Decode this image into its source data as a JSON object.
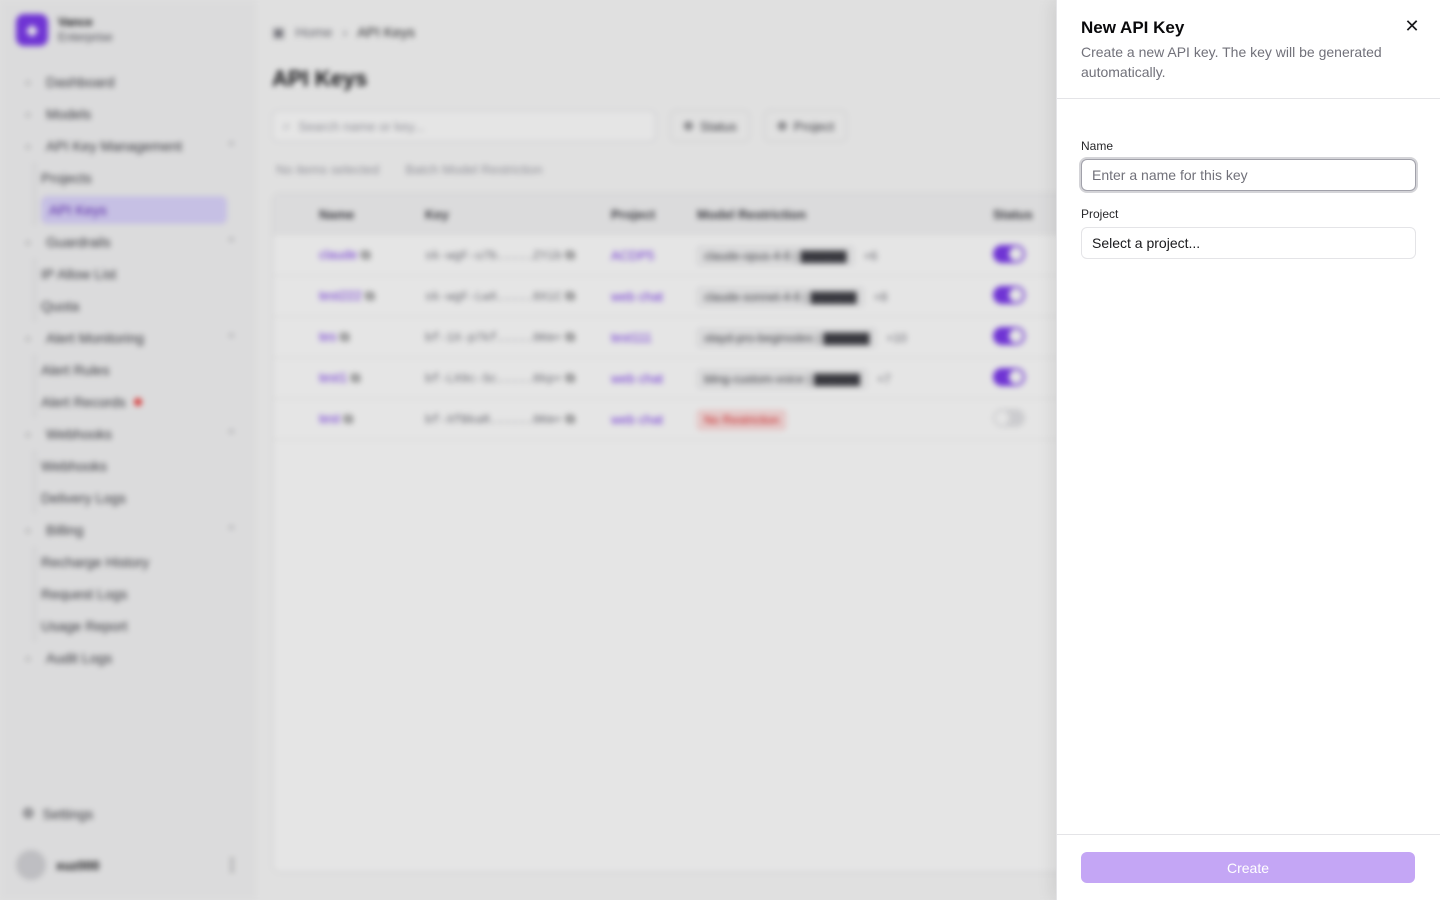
{
  "sidebar": {
    "brand_name": "Vance",
    "brand_sub": "Enterprise",
    "items": [
      {
        "label": "Dashboard",
        "type": "item",
        "icon": "dashboard-icon"
      },
      {
        "label": "Models",
        "type": "item",
        "icon": "models-icon"
      },
      {
        "label": "API Key Management",
        "type": "group",
        "icon": "key-icon"
      },
      {
        "label": "Projects",
        "type": "sub"
      },
      {
        "label": "API Keys",
        "type": "sub",
        "active": true
      },
      {
        "label": "Guardrails",
        "type": "group",
        "icon": "shield-icon"
      },
      {
        "label": "IP Allow List",
        "type": "sub"
      },
      {
        "label": "Quota",
        "type": "sub"
      },
      {
        "label": "Alert Monitoring",
        "type": "group",
        "icon": "alert-icon"
      },
      {
        "label": "Alert Rules",
        "type": "sub"
      },
      {
        "label": "Alert Records",
        "type": "sub",
        "badge": true
      },
      {
        "label": "Webhooks",
        "type": "group",
        "icon": "webhook-icon"
      },
      {
        "label": "Webhooks",
        "type": "sub"
      },
      {
        "label": "Delivery Logs",
        "type": "sub"
      },
      {
        "label": "Billing",
        "type": "group",
        "icon": "billing-icon"
      },
      {
        "label": "Recharge History",
        "type": "sub"
      },
      {
        "label": "Request Logs",
        "type": "sub"
      },
      {
        "label": "Usage Report",
        "type": "sub"
      },
      {
        "label": "Audit Logs",
        "type": "item",
        "icon": "audit-icon"
      }
    ],
    "settings_label": "Settings",
    "user_name": "xuz000"
  },
  "main": {
    "breadcrumb": {
      "home": "Home",
      "current": "API Keys"
    },
    "title": "API Keys",
    "search_placeholder": "Search name or key...",
    "filters": {
      "status": "Status",
      "project": "Project"
    },
    "selection": {
      "text": "No items selected",
      "action": "Batch Model Restriction"
    },
    "columns": {
      "name": "Name",
      "key": "Key",
      "project": "Project",
      "restriction": "Model Restriction",
      "status": "Status"
    },
    "rows": [
      {
        "name": "claude",
        "key": "sk-wgF-u7b.....ZYib",
        "project": "ACDP5",
        "restriction": "claude-opus-4-6 | ▇▇▇▇▇",
        "extra": "+6",
        "enabled": true
      },
      {
        "name": "test222",
        "key": "sk-wgF-LwX.....8XiC",
        "project": "web chat",
        "restriction": "claude-sonnet-4-6 | ▇▇▇▇▇",
        "extra": "+8",
        "enabled": true
      },
      {
        "name": "tes",
        "key": "bf-1X-p7kf.....8Km+",
        "project": "test111",
        "restriction": "olayd-pro-beginodes | ▇▇▇▇▇",
        "extra": "+10",
        "enabled": true
      },
      {
        "name": "test1",
        "key": "bf-LX9c-Sc.....8kp+",
        "project": "web chat",
        "restriction": "bling-custom-voice | ▇▇▇▇▇",
        "extra": "+7",
        "enabled": true
      },
      {
        "name": "test",
        "key": "bf-XfBkaR......8Km+",
        "project": "web chat",
        "restriction": "No Restriction",
        "extra": "",
        "enabled": false,
        "red": true
      }
    ]
  },
  "drawer": {
    "title": "New API Key",
    "description": "Create a new API key. The key will be generated automatically.",
    "close_label": "✕",
    "name_label": "Name",
    "name_placeholder": "Enter a name for this key",
    "name_value": "",
    "project_label": "Project",
    "project_value": "Select a project...",
    "create_label": "Create"
  },
  "colors": {
    "accent": "#7c3aed",
    "create_disabled": "#c4a6f5"
  }
}
